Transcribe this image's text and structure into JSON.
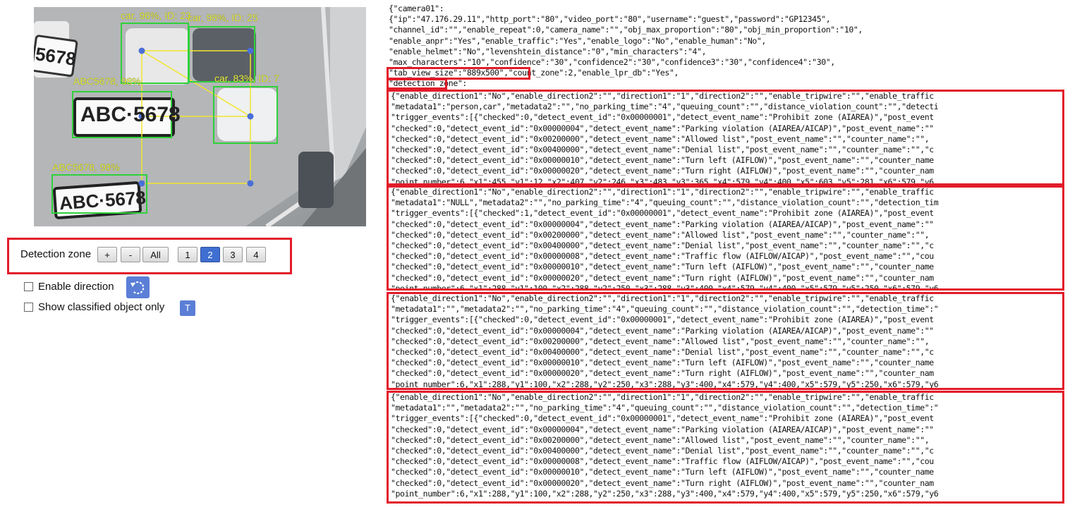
{
  "camera": {
    "detections": [
      {
        "label": "car, 96%, ID: 23"
      },
      {
        "label": "car, 98%, ID: 25"
      },
      {
        "label": "ABC5678, 98%"
      },
      {
        "label": "car, 83%, ID: 7"
      },
      {
        "label": "ABC5678, 98%"
      }
    ],
    "plates": [
      "5678",
      "ABC·5678",
      "ABC·5678"
    ]
  },
  "controls": {
    "detection_zone_label": "Detection zone",
    "buttons": [
      "+",
      "-",
      "All",
      "1",
      "2",
      "3",
      "4"
    ],
    "active_zone": "2",
    "enable_direction_label": "Enable direction",
    "show_classified_label": "Show classified object only",
    "t_button": "T"
  },
  "config": {
    "header_lines": [
      "{\"camera01\":",
      "{\"ip\":\"47.176.29.11\",\"http_port\":\"80\",\"video_port\":\"80\",\"username\":\"guest\",\"password\":\"GP12345\",",
      "\"channel_id\":\"\",\"enable_repeat\":0,\"camera_name\":\"\",\"obj_max_proportion\":\"80\",\"obj_min_proportion\":\"10\",",
      "\"enable_anpr\":\"Yes\",\"enable_traffic\":\"Yes\",\"enable_logo\":\"No\",\"enable_human\":\"No\",",
      "\"enable_helmet\":\"No\",\"levenshtein_distance\":\"0\",\"min_characters\":\"4\",",
      "\"max_characters\":\"10\",\"confidence\":\"30\",\"confidence2\":\"30\",\"confidence3\":\"30\",\"confidence4\":\"30\",",
      "\"tab_view_size\":\"889x500\",\"count_zone\":2,\"enable_lpr_db\":\"Yes\",",
      "\"detection_zone\":"
    ],
    "zones": [
      [
        "{\"enable_direction1\":\"No\",\"enable_direction2\":\"\",\"direction1\":\"1\",\"direction2\":\"\",\"enable_tripwire\":\"\",\"enable_traffic",
        "\"metadata1\":\"person,car\",\"metadata2\":\"\",\"no_parking_time\":\"4\",\"queuing_count\":\"\",\"distance_violation_count\":\"\",\"detecti",
        "\"trigger_events\":[{\"checked\":0,\"detect_event_id\":\"0x00000001\",\"detect_event_name\":\"Prohibit zone (AIAREA)\",\"post_event",
        "\"checked\":0,\"detect_event_id\":\"0x00000004\",\"detect_event_name\":\"Parking violation (AIAREA/AICAP)\",\"post_event_name\":\"\"",
        "\"checked\":0,\"detect_event_id\":\"0x00200000\",\"detect_event_name\":\"Allowed list\",\"post_event_name\":\"\",\"counter_name\":\"\",",
        "\"checked\":0,\"detect_event_id\":\"0x00400000\",\"detect_event_name\":\"Denial list\",\"post_event_name\":\"\",\"counter_name\":\"\",\"c",
        "\"checked\":0,\"detect_event_id\":\"0x00000010\",\"detect_event_name\":\"Turn left (AIFLOW)\",\"post_event_name\":\"\",\"counter_name",
        "\"checked\":0,\"detect_event_id\":\"0x00000020\",\"detect_event_name\":\"Turn right (AIFLOW)\",\"post_event_name\":\"\",\"counter_nam",
        "\"point_number\":6,\"x1\":455,\"y1\":12,\"x2\":407,\"y2\":246,\"x3\":483,\"y3\":365,\"x4\":579,\"y4\":400,\"x5\":603,\"y5\":281,\"x6\":579,\"y6"
      ],
      [
        "{\"enable_direction1\":\"No\",\"enable_direction2\":\"\",\"direction1\":\"1\",\"direction2\":\"\",\"enable_tripwire\":\"\",\"enable_traffic",
        "\"metadata1\":\"NULL\",\"metadata2\":\"\",\"no_parking_time\":\"4\",\"queuing_count\":\"\",\"distance_violation_count\":\"\",\"detection_tim",
        "\"trigger_events\":[{\"checked\":1,\"detect_event_id\":\"0x00000001\",\"detect_event_name\":\"Prohibit zone (AIAREA)\",\"post_event",
        "\"checked\":0,\"detect_event_id\":\"0x00000004\",\"detect_event_name\":\"Parking violation (AIAREA/AICAP)\",\"post_event_name\":\"\"",
        "\"checked\":0,\"detect_event_id\":\"0x00200000\",\"detect_event_name\":\"Allowed list\",\"post_event_name\":\"\",\"counter_name\":\"\",",
        "\"checked\":0,\"detect_event_id\":\"0x00400000\",\"detect_event_name\":\"Denial list\",\"post_event_name\":\"\",\"counter_name\":\"\",\"c",
        "\"checked\":0,\"detect_event_id\":\"0x00000008\",\"detect_event_name\":\"Traffic flow (AIFLOW/AICAP)\",\"post_event_name\":\"\",\"cou",
        "\"checked\":0,\"detect_event_id\":\"0x00000010\",\"detect_event_name\":\"Turn left (AIFLOW)\",\"post_event_name\":\"\",\"counter_name",
        "\"checked\":0,\"detect_event_id\":\"0x00000020\",\"detect_event_name\":\"Turn right (AIFLOW)\",\"post_event_name\":\"\",\"counter_nam",
        "\"point_number\":6,\"x1\":288,\"y1\":100,\"x2\":288,\"y2\":250,\"x3\":288,\"y3\":400,\"x4\":579,\"y4\":400,\"x5\":579,\"y5\":250,\"x6\":579,\"y6"
      ],
      [
        "{\"enable_direction1\":\"No\",\"enable_direction2\":\"\",\"direction1\":\"1\",\"direction2\":\"\",\"enable_tripwire\":\"\",\"enable_traffic",
        "\"metadata1\":\"\",\"metadata2\":\"\",\"no_parking_time\":\"4\",\"queuing_count\":\"\",\"distance_violation_count\":\"\",\"detection_time\":\"",
        "\"trigger_events\":[{\"checked\":0,\"detect_event_id\":\"0x00000001\",\"detect_event_name\":\"Prohibit zone (AIAREA)\",\"post_event",
        "\"checked\":0,\"detect_event_id\":\"0x00000004\",\"detect_event_name\":\"Parking violation (AIAREA/AICAP)\",\"post_event_name\":\"\"",
        "\"checked\":0,\"detect_event_id\":\"0x00200000\",\"detect_event_name\":\"Allowed list\",\"post_event_name\":\"\",\"counter_name\":\"\",",
        "\"checked\":0,\"detect_event_id\":\"0x00400000\",\"detect_event_name\":\"Denial list\",\"post_event_name\":\"\",\"counter_name\":\"\",\"c",
        "\"checked\":0,\"detect_event_id\":\"0x00000010\",\"detect_event_name\":\"Turn left (AIFLOW)\",\"post_event_name\":\"\",\"counter_name",
        "\"checked\":0,\"detect_event_id\":\"0x00000020\",\"detect_event_name\":\"Turn right (AIFLOW)\",\"post_event_name\":\"\",\"counter_nam",
        "\"point_number\":6,\"x1\":288,\"y1\":100,\"x2\":288,\"y2\":250,\"x3\":288,\"y3\":400,\"x4\":579,\"y4\":400,\"x5\":579,\"y5\":250,\"x6\":579,\"y6"
      ],
      [
        "{\"enable_direction1\":\"No\",\"enable_direction2\":\"\",\"direction1\":\"1\",\"direction2\":\"\",\"enable_tripwire\":\"\",\"enable_traffic",
        "\"metadata1\":\"\",\"metadata2\":\"\",\"no_parking_time\":\"4\",\"queuing_count\":\"\",\"distance_violation_count\":\"\",\"detection_time\":\"",
        "\"trigger_events\":[{\"checked\":0,\"detect_event_id\":\"0x00000001\",\"detect_event_name\":\"Prohibit zone (AIAREA)\",\"post_event",
        "\"checked\":0,\"detect_event_id\":\"0x00000004\",\"detect_event_name\":\"Parking violation (AIAREA/AICAP)\",\"post_event_name\":\"\"",
        "\"checked\":0,\"detect_event_id\":\"0x00200000\",\"detect_event_name\":\"Allowed list\",\"post_event_name\":\"\",\"counter_name\":\"\",",
        "\"checked\":0,\"detect_event_id\":\"0x00400000\",\"detect_event_name\":\"Denial list\",\"post_event_name\":\"\",\"counter_name\":\"\",\"c",
        "\"checked\":0,\"detect_event_id\":\"0x00000008\",\"detect_event_name\":\"Traffic flow (AIFLOW/AICAP)\",\"post_event_name\":\"\",\"cou",
        "\"checked\":0,\"detect_event_id\":\"0x00000010\",\"detect_event_name\":\"Turn left (AIFLOW)\",\"post_event_name\":\"\",\"counter_name",
        "\"checked\":0,\"detect_event_id\":\"0x00000020\",\"detect_event_name\":\"Turn right (AIFLOW)\",\"post_event_name\":\"\",\"counter_nam",
        "\"point_number\":6,\"x1\":288,\"y1\":100,\"x2\":288,\"y2\":250,\"x3\":288,\"y3\":400,\"x4\":579,\"y4\":400,\"x5\":579,\"y5\":250,\"x6\":579,\"y6"
      ]
    ]
  },
  "colors": {
    "highlight": "#e21c2a",
    "box": "#2fd13a",
    "zone_line": "#f2e62c",
    "point": "#4a6fd8",
    "label": "#e9f23a",
    "active_button": "#3f6fd1"
  }
}
